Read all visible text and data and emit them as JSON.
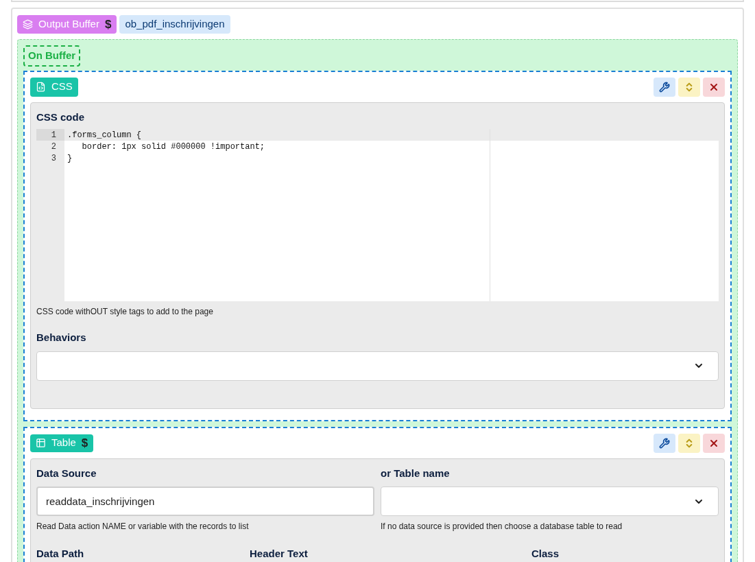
{
  "header": {
    "block_badge": {
      "label": "Output Buffer",
      "dollar": "$"
    },
    "name_tag": "ob_pdf_inschrijvingen"
  },
  "container": {
    "label": "On Buffer"
  },
  "css_block": {
    "badge": {
      "label": "CSS"
    },
    "panel": {
      "code_label": "CSS code",
      "code_lines": [
        {
          "number": "1",
          "text": ".forms_column {",
          "active": true
        },
        {
          "number": "2",
          "text": "   border: 1px solid #000000 !important;",
          "active": false
        },
        {
          "number": "3",
          "text": "}",
          "active": false
        }
      ],
      "code_help": "CSS code withOUT style tags to add to the page",
      "behaviors_label": "Behaviors"
    }
  },
  "table_block": {
    "badge": {
      "label": "Table",
      "dollar": "$"
    },
    "panel": {
      "data_source": {
        "label": "Data Source",
        "value": "readdata_inschrijvingen",
        "help": "Read Data action NAME or variable with the records to list"
      },
      "table_name": {
        "label": "or Table name",
        "help": "If no data source is provided then choose a database table to read"
      },
      "columns": [
        {
          "label": "Data Path"
        },
        {
          "label": "Header Text"
        },
        {
          "label": "Class"
        }
      ]
    }
  }
}
